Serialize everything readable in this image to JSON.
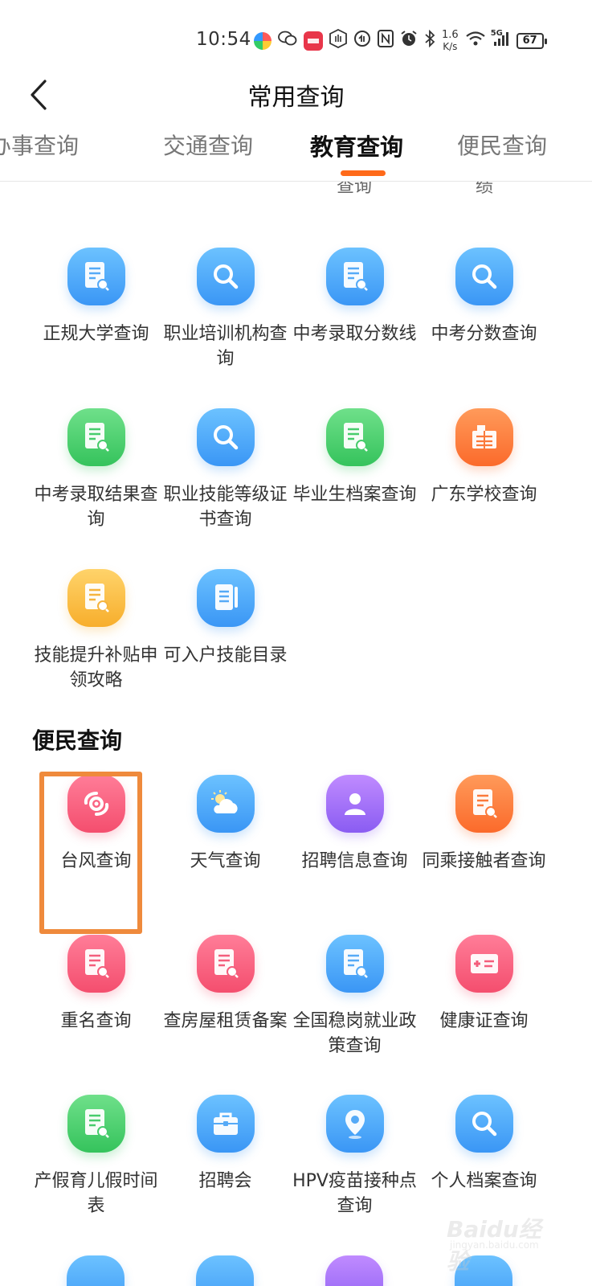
{
  "status_bar": {
    "time": "10:54",
    "net_speed": "1.6",
    "net_speed_unit": "K/s",
    "signal": "5G",
    "battery": "67"
  },
  "header": {
    "title": "常用查询"
  },
  "tabs": [
    {
      "label": "办事查询",
      "visible_text": "​事查询"
    },
    {
      "label": "交通查询"
    },
    {
      "label": "教育查询",
      "active": true
    },
    {
      "label": "便民查询"
    }
  ],
  "clipped_row": [
    "查询",
    "绩"
  ],
  "education_items": [
    {
      "label": "正规大学查询",
      "icon": "document-search-icon",
      "color": "blue"
    },
    {
      "label": "职业培训机构查询",
      "icon": "search-icon",
      "color": "blue"
    },
    {
      "label": "中考录取分数线",
      "icon": "document-search-icon",
      "color": "blue"
    },
    {
      "label": "中考分数查询",
      "icon": "search-icon",
      "color": "blue"
    },
    {
      "label": "中考录取结果查询",
      "icon": "document-search-icon",
      "color": "green"
    },
    {
      "label": "职业技能等级证书查询",
      "icon": "search-icon",
      "color": "blue"
    },
    {
      "label": "毕业生档案查询",
      "icon": "document-search-icon",
      "color": "green"
    },
    {
      "label": "广东学校查询",
      "icon": "school-building-icon",
      "color": "orange"
    },
    {
      "label": "技能提升补贴申领攻略",
      "icon": "document-search-icon",
      "color": "yellow"
    },
    {
      "label": "可入户技能目录",
      "icon": "notebook-icon",
      "color": "blue"
    }
  ],
  "convenience_section": {
    "title": "便民查询",
    "items": [
      {
        "label": "台风查询",
        "icon": "typhoon-icon",
        "color": "pink",
        "highlighted": true
      },
      {
        "label": "天气查询",
        "icon": "weather-icon",
        "color": "blue"
      },
      {
        "label": "招聘信息查询",
        "icon": "person-icon",
        "color": "purple"
      },
      {
        "label": "同乘接触者查询",
        "icon": "document-search-icon",
        "color": "orange"
      },
      {
        "label": "重名查询",
        "icon": "document-search-icon",
        "color": "pink"
      },
      {
        "label": "查房屋租赁备案",
        "icon": "document-search-icon",
        "color": "pink"
      },
      {
        "label": "全国稳岗就业政策查询",
        "icon": "document-search-icon",
        "color": "blue"
      },
      {
        "label": "健康证查询",
        "icon": "id-card-icon",
        "color": "pink"
      },
      {
        "label": "产假育儿假时间表",
        "icon": "document-search-icon",
        "color": "green"
      },
      {
        "label": "招聘会",
        "icon": "briefcase-icon",
        "color": "blue"
      },
      {
        "label": "HPV疫苗接种点查询",
        "icon": "location-pin-icon",
        "color": "blue"
      },
      {
        "label": "个人档案查询",
        "icon": "search-icon",
        "color": "blue"
      }
    ]
  },
  "watermark": {
    "text": "Baidu经验",
    "sub": "jingyan.baidu.com"
  },
  "colors": {
    "accent": "#ff6a1a",
    "highlight_box": "#ef8a3c"
  }
}
